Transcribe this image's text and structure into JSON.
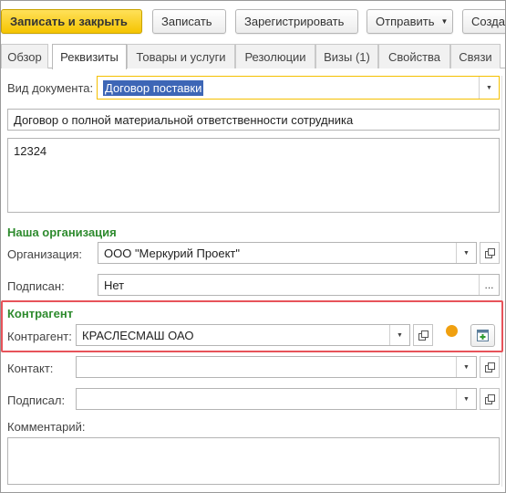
{
  "toolbar": {
    "save_close": "Записать и закрыть",
    "save": "Записать",
    "register": "Зарегистрировать",
    "send": "Отправить",
    "create": "Созда"
  },
  "tabs": [
    {
      "label": "Обзор"
    },
    {
      "label": "Реквизиты",
      "active": true
    },
    {
      "label": "Товары и услуги"
    },
    {
      "label": "Резолюции"
    },
    {
      "label": "Визы (1)"
    },
    {
      "label": "Свойства"
    },
    {
      "label": "Связи"
    }
  ],
  "form": {
    "doc_type_label": "Вид документа:",
    "doc_type_value": "Договор поставки",
    "title_value": "Договор о полной материальной ответственности сотрудника",
    "description_value": "12324",
    "our_org_section": "Наша организация",
    "organization_label": "Организация:",
    "organization_value": "ООО \"Меркурий Проект\"",
    "signed_label_1": "Подписан:",
    "signed_value_1": "Нет",
    "counterparty_section": "Контрагент",
    "counterparty_label": "Контрагент:",
    "counterparty_value": "КРАСЛЕСМАШ  ОАО",
    "contact_label": "Контакт:",
    "contact_value": "",
    "signed_label_2": "Подписал:",
    "signed_value_2": "",
    "comment_label": "Комментарий:",
    "comment_value": ""
  },
  "colors": {
    "primary_button": "#f5c400",
    "section_header": "#2e8b2e",
    "highlight_border": "#e7535a",
    "status_indicator": "#f0a010",
    "selection": "#3d66b6"
  },
  "icons": [
    "dropdown-arrow-icon",
    "open-icon",
    "ellipsis-icon",
    "create-new-icon",
    "status-dot-icon"
  ]
}
